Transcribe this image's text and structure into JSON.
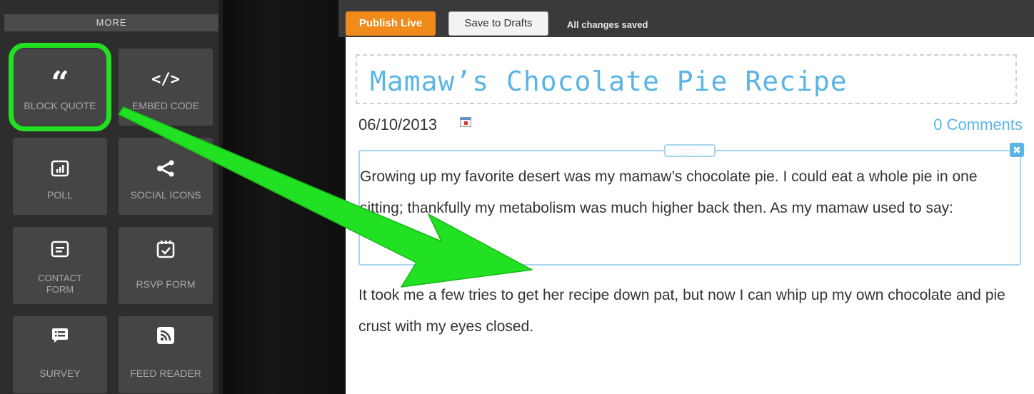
{
  "sidebar": {
    "header": "MORE",
    "tiles": [
      {
        "label": "BLOCK QUOTE",
        "icon": "quote-icon"
      },
      {
        "label": "EMBED CODE",
        "icon": "code-icon"
      },
      {
        "label": "POLL",
        "icon": "poll-icon"
      },
      {
        "label": "SOCIAL ICONS",
        "icon": "share-icon"
      },
      {
        "label": "CONTACT FORM",
        "icon": "form-icon"
      },
      {
        "label": "RSVP FORM",
        "icon": "calendar-check-icon"
      },
      {
        "label": "SURVEY",
        "icon": "list-icon"
      },
      {
        "label": "FEED READER",
        "icon": "rss-icon"
      }
    ]
  },
  "toolbar": {
    "publish_label": "Publish Live",
    "save_label": "Save to Drafts",
    "status": "All changes saved"
  },
  "post": {
    "title": "Mamaw’s Chocolate Pie Recipe",
    "date": "06/10/2013",
    "comments": "0 Comments",
    "paragraph_1": "Growing up my favorite desert was my mamaw’s chocolate pie. I could eat a whole pie in one sitting; thankfully my metabolism was much higher back then. As my mamaw used to say:",
    "paragraph_2": "It took me a few tries to get her recipe down pat, but now I can whip up my own chocolate and pie crust with my eyes closed."
  },
  "colors": {
    "publish": "#f08a1a",
    "accent": "#5ab5e6",
    "annotation": "#22e022"
  }
}
